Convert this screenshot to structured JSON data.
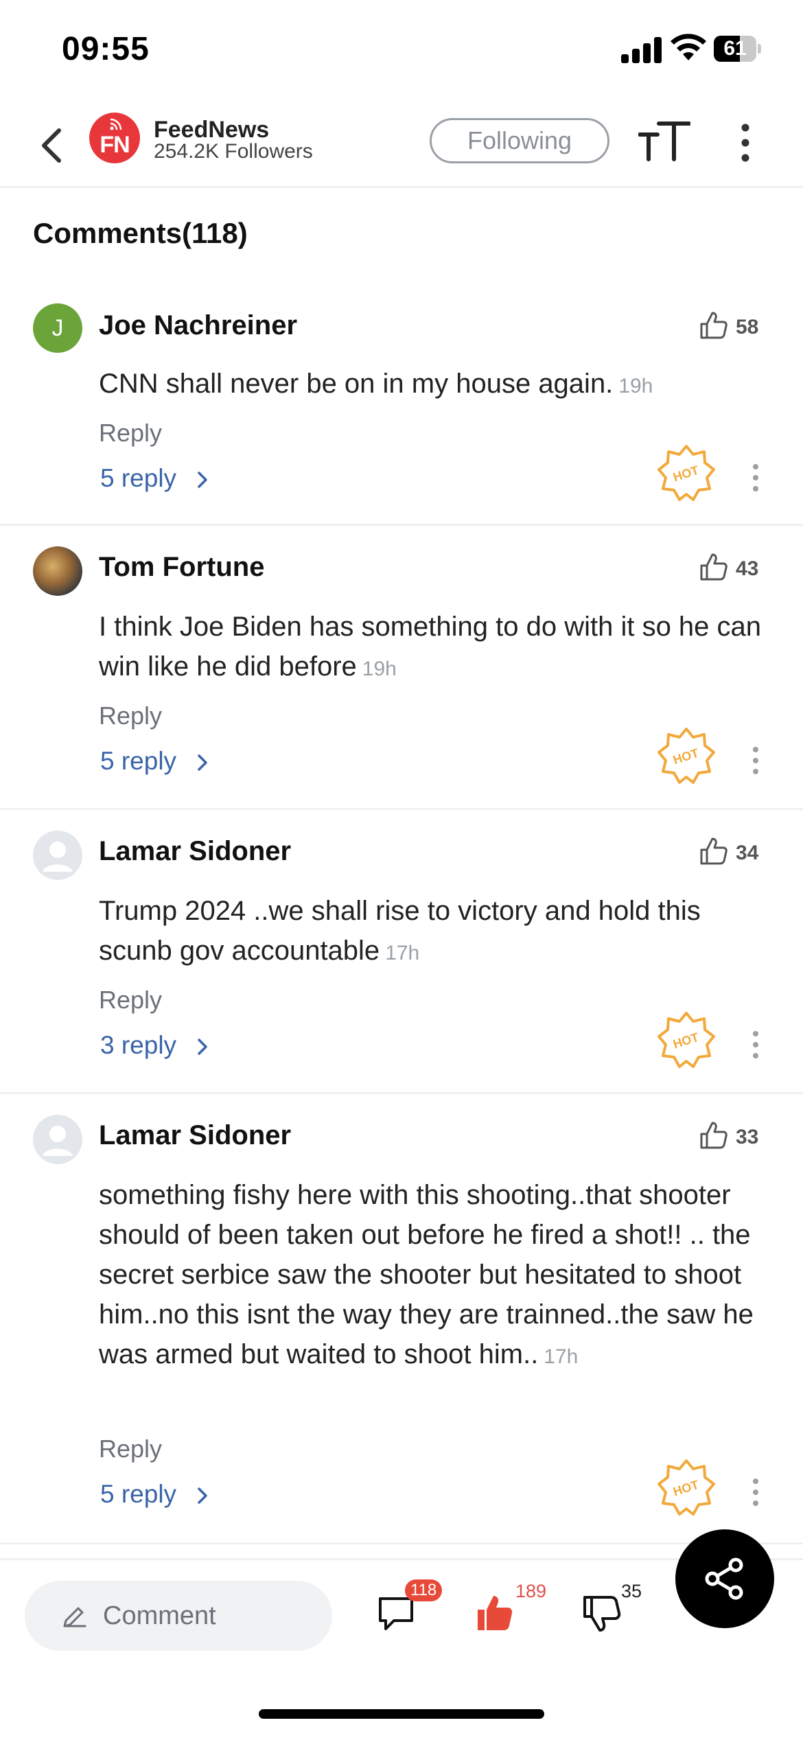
{
  "status_bar": {
    "time": "09:55",
    "battery": "61",
    "battery_level": 0.61
  },
  "header": {
    "channel_logo_text": "FN",
    "channel_name": "FeedNews",
    "followers": "254.2K Followers",
    "follow_button": "Following"
  },
  "comments_title": "Comments(118)",
  "comments": [
    {
      "avatar_initial": "J",
      "name": "Joe Nachreiner",
      "likes": "58",
      "text": "CNN shall never be on in my house again.",
      "time": "19h",
      "reply_label": "Reply",
      "replies_label": "5 reply",
      "hot": "HOT"
    },
    {
      "avatar_initial": "",
      "name": "Tom Fortune",
      "likes": "43",
      "text": "I think Joe Biden has something to do with it so he can win like he did before",
      "time": "19h",
      "reply_label": "Reply",
      "replies_label": "5 reply",
      "hot": "HOT"
    },
    {
      "avatar_initial": "",
      "name": "Lamar Sidoner",
      "likes": "34",
      "text": "Trump 2024 ..we shall rise to victory and hold this scunb gov accountable",
      "time": "17h",
      "reply_label": "Reply",
      "replies_label": "3 reply",
      "hot": "HOT"
    },
    {
      "avatar_initial": "",
      "name": "Lamar Sidoner",
      "likes": "33",
      "text": "something fishy here with this shooting..that shooter should of been taken out before he fired a shot!! .. the secret serbice saw the shooter but hesitated to shoot him..no this isnt the way they are trainned..the saw he was armed but waited to shoot him..",
      "time": "17h",
      "reply_label": "Reply",
      "replies_label": "5 reply",
      "hot": "HOT"
    }
  ],
  "bottom_bar": {
    "comment_placeholder": "Comment",
    "comments_count": "118",
    "likes_count": "189",
    "dislikes_count": "35"
  },
  "icons": [
    "back-arrow-icon",
    "rss-icon",
    "text-size-icon",
    "more-vertical-icon",
    "thumbs-up-icon",
    "hot-badge-icon",
    "chevron-right-icon",
    "pencil-icon",
    "speech-bubble-icon",
    "thumbs-down-icon",
    "share-icon"
  ],
  "colors": {
    "brand_red": "#e8373a",
    "link_blue": "#3a64a8",
    "hot_orange": "#f2a93b",
    "accent_red": "#e84a3a"
  }
}
